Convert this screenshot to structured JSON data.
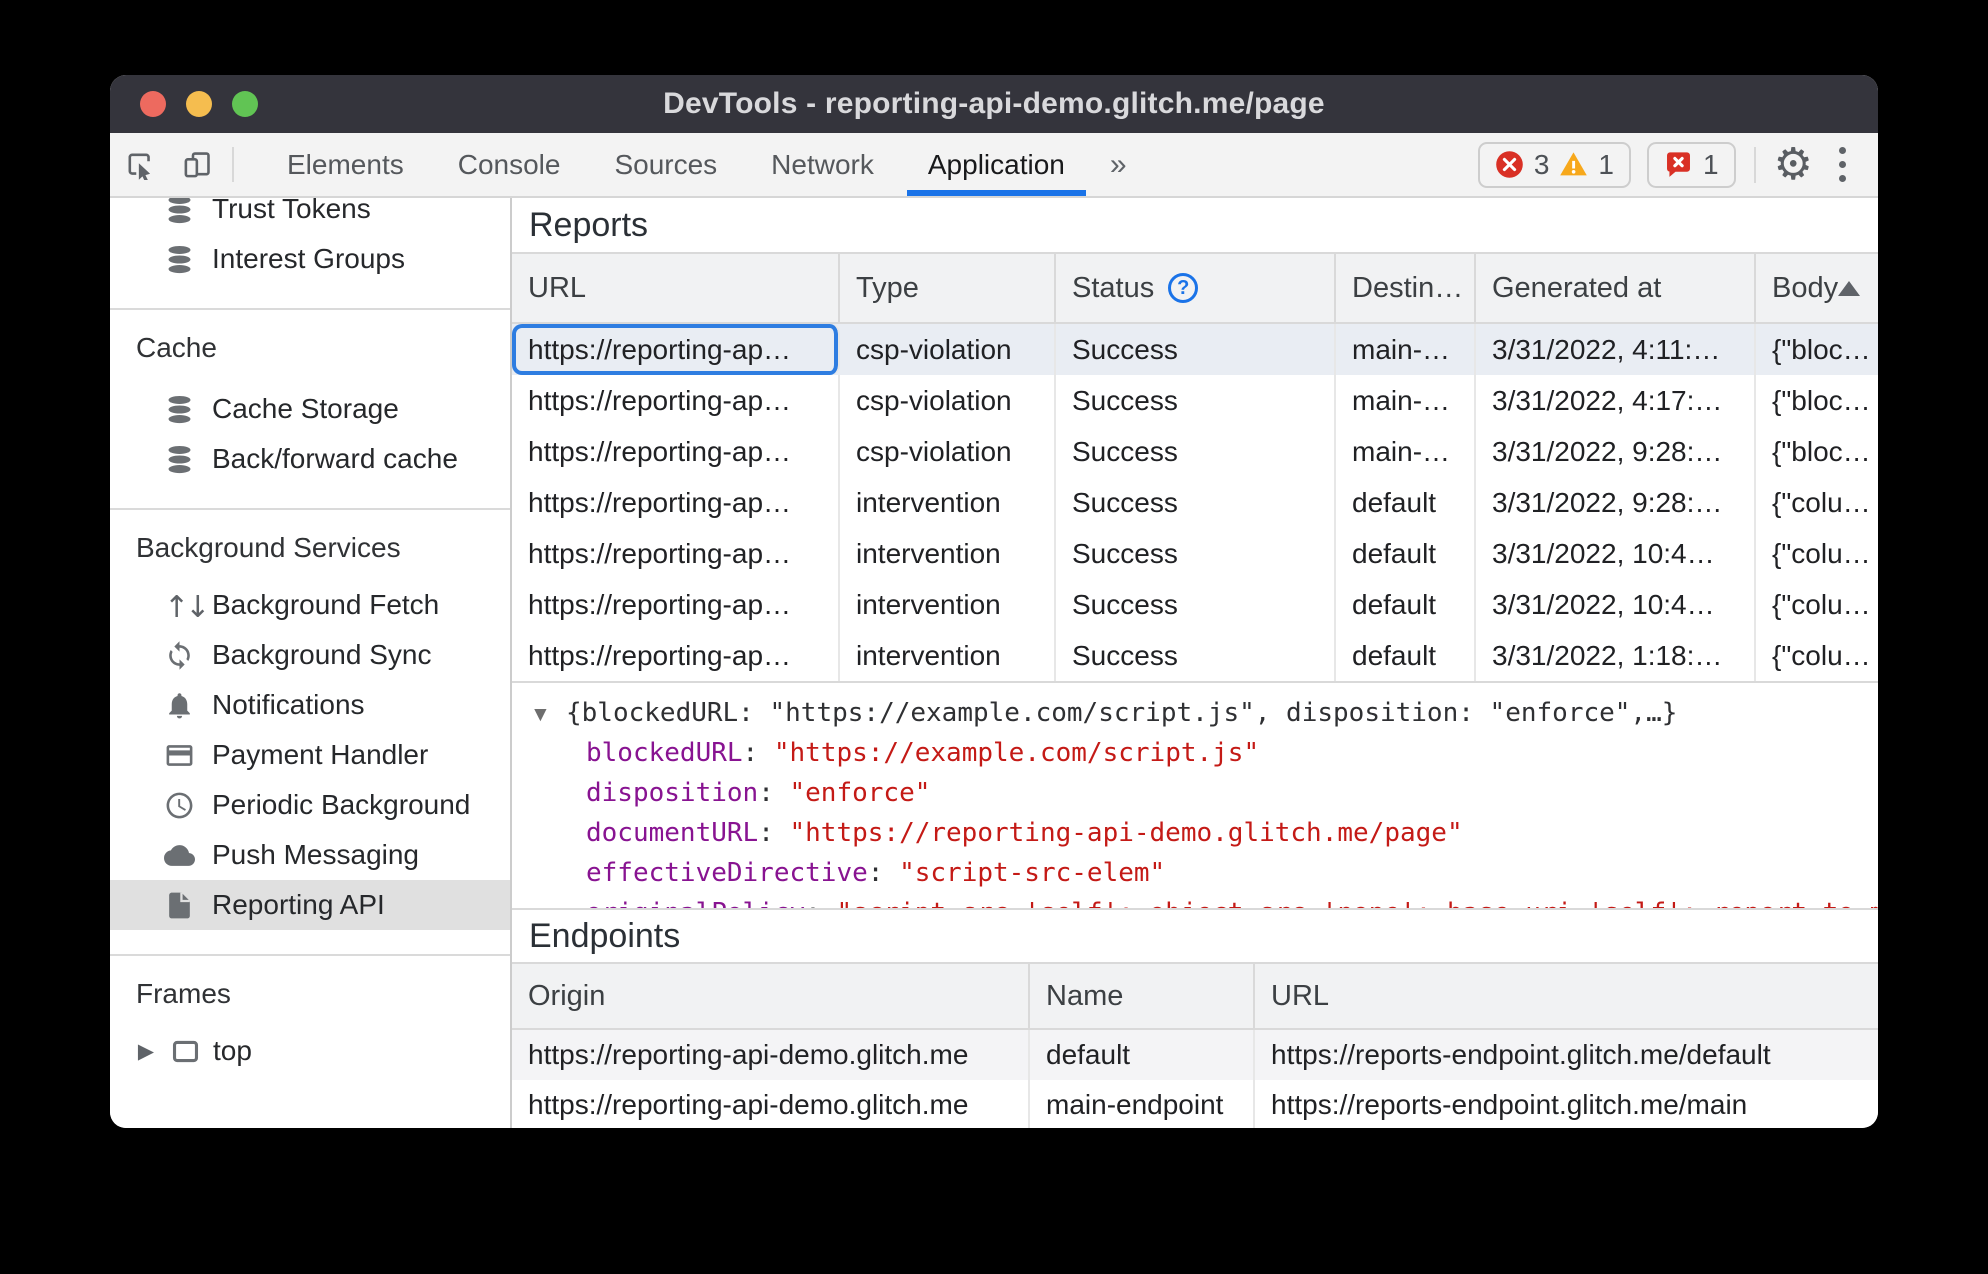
{
  "window": {
    "title": "DevTools - reporting-api-demo.glitch.me/page"
  },
  "toolbar": {
    "tabs": [
      {
        "label": "Elements"
      },
      {
        "label": "Console"
      },
      {
        "label": "Sources"
      },
      {
        "label": "Network"
      },
      {
        "label": "Application"
      }
    ],
    "selected_tab": "Application",
    "more_tabs": "»",
    "error_count": "3",
    "warning_count": "1",
    "issues_count": "1"
  },
  "icons": {
    "expanded": "▼",
    "collapsed": "▶",
    "fetch": "↑↓",
    "gear": "⚙"
  },
  "sidebar": {
    "top_items": [
      {
        "label": "Trust Tokens"
      },
      {
        "label": "Interest Groups"
      }
    ],
    "cache_section": {
      "title": "Cache",
      "items": [
        "Cache Storage",
        "Back/forward cache"
      ]
    },
    "bg_section": {
      "title": "Background Services",
      "items": [
        "Background Fetch",
        "Background Sync",
        "Notifications",
        "Payment Handler",
        "Periodic Background",
        "Push Messaging",
        "Reporting API"
      ]
    },
    "frames_section": {
      "title": "Frames",
      "items": [
        "top"
      ]
    }
  },
  "reports": {
    "title": "Reports",
    "columns": {
      "url": "URL",
      "type": "Type",
      "status": "Status",
      "destination": "Destin…",
      "generated": "Generated at",
      "body": "Body"
    },
    "rows": [
      {
        "url": "https://reporting-ap…",
        "type": "csp-violation",
        "status": "Success",
        "destination": "main-…",
        "generated": "3/31/2022, 4:11:…",
        "body": "{\"bloc…"
      },
      {
        "url": "https://reporting-ap…",
        "type": "csp-violation",
        "status": "Success",
        "destination": "main-…",
        "generated": "3/31/2022, 4:17:…",
        "body": "{\"bloc…"
      },
      {
        "url": "https://reporting-ap…",
        "type": "csp-violation",
        "status": "Success",
        "destination": "main-…",
        "generated": "3/31/2022, 9:28:…",
        "body": "{\"bloc…"
      },
      {
        "url": "https://reporting-ap…",
        "type": "intervention",
        "status": "Success",
        "destination": "default",
        "generated": "3/31/2022, 9:28:…",
        "body": "{\"colu…"
      },
      {
        "url": "https://reporting-ap…",
        "type": "intervention",
        "status": "Success",
        "destination": "default",
        "generated": "3/31/2022, 10:4…",
        "body": "{\"colu…"
      },
      {
        "url": "https://reporting-ap…",
        "type": "intervention",
        "status": "Success",
        "destination": "default",
        "generated": "3/31/2022, 10:4…",
        "body": "{\"colu…"
      },
      {
        "url": "https://reporting-ap…",
        "type": "intervention",
        "status": "Success",
        "destination": "default",
        "generated": "3/31/2022, 1:18:…",
        "body": "{\"colu…"
      }
    ]
  },
  "report_detail": {
    "preview": "{blockedURL: \"https://example.com/script.js\", disposition: \"enforce\",…}",
    "separator": ": ",
    "properties": [
      {
        "key": "blockedURL",
        "value": "\"https://example.com/script.js\""
      },
      {
        "key": "disposition",
        "value": "\"enforce\""
      },
      {
        "key": "documentURL",
        "value": "\"https://reporting-api-demo.glitch.me/page\""
      },
      {
        "key": "effectiveDirective",
        "value": "\"script-src-elem\""
      },
      {
        "key": "originalPolicy",
        "value": "\"script-src 'self'; object-src 'none'; base-uri 'self'; report-to main-endpoint\""
      }
    ]
  },
  "endpoints": {
    "title": "Endpoints",
    "columns": {
      "origin": "Origin",
      "name": "Name",
      "url": "URL"
    },
    "rows": [
      {
        "origin": "https://reporting-api-demo.glitch.me",
        "name": "default",
        "url": "https://reports-endpoint.glitch.me/default"
      },
      {
        "origin": "https://reporting-api-demo.glitch.me",
        "name": "main-endpoint",
        "url": "https://reports-endpoint.glitch.me/main"
      }
    ]
  },
  "colors": {
    "accent": "#1a73e8",
    "error": "#d93025",
    "warning": "#f7a81b",
    "titlebar": "#34343c",
    "json_key": "#881391",
    "json_string": "#c41a16"
  }
}
